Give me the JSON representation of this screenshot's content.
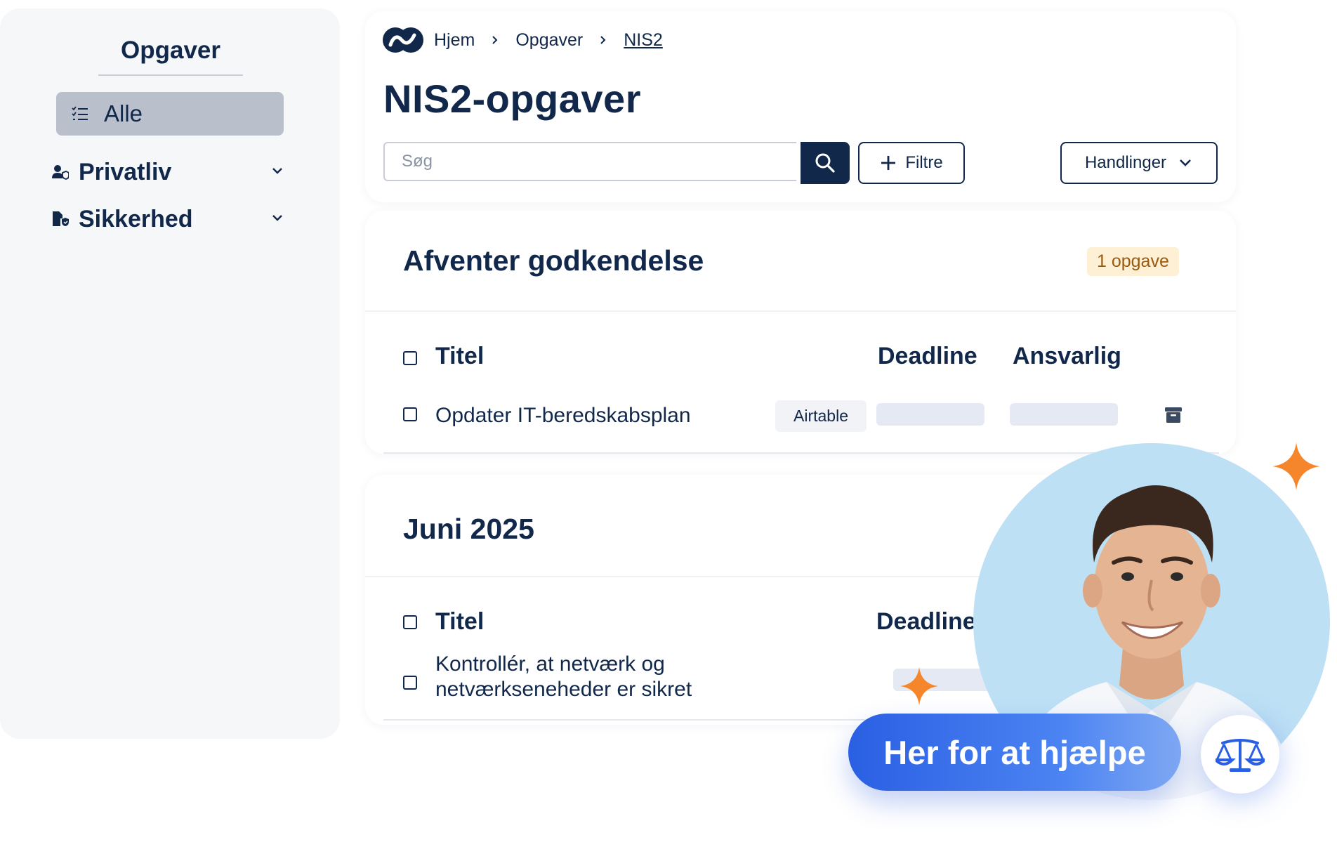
{
  "sidebar": {
    "title": "Opgaver",
    "items": [
      {
        "label": "Alle",
        "icon": "list-check-icon",
        "active": true
      },
      {
        "label": "Privatliv",
        "icon": "user-shield-icon"
      },
      {
        "label": "Sikkerhed",
        "icon": "file-shield-icon"
      }
    ]
  },
  "breadcrumb": {
    "items": [
      "Hjem",
      "Opgaver",
      "NIS2"
    ]
  },
  "page": {
    "title": "NIS2-opgaver"
  },
  "toolbar": {
    "search_placeholder": "Søg",
    "filter_label": "Filtre",
    "actions_label": "Handlinger"
  },
  "sections": [
    {
      "title": "Afventer godkendelse",
      "badge": "1 opgave",
      "columns": [
        "Titel",
        "Deadline",
        "Ansvarlig"
      ],
      "rows": [
        {
          "title": "Opdater IT-beredskabsplan",
          "tag": "Airtable"
        }
      ]
    },
    {
      "title": "Juni 2025",
      "columns": [
        "Titel",
        "Deadline"
      ],
      "rows": [
        {
          "title_line1": "Kontrollér, at netværk og",
          "title_line2": "netværkseneheder er sikret"
        }
      ]
    }
  ],
  "help": {
    "label": "Her for at hjælpe"
  },
  "colors": {
    "navy": "#12284b",
    "accent_blue": "#2a5fe3",
    "sparkle_orange": "#f6862b",
    "badge_bg": "#fdf0d5"
  }
}
